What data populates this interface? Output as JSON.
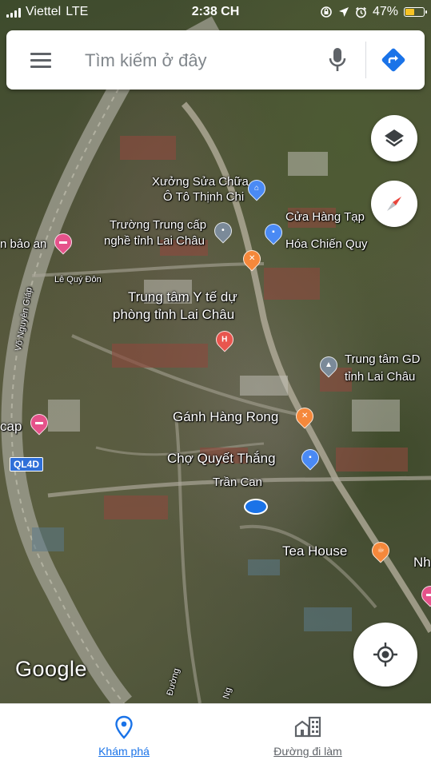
{
  "status_bar": {
    "carrier": "Viettel",
    "network": "LTE",
    "time": "2:38 CH",
    "battery_percent": "47%",
    "battery_level": 0.47
  },
  "search": {
    "placeholder": "Tìm kiếm ở đây"
  },
  "map": {
    "labels": {
      "xuong_sua_chua_1": "Xưởng Sửa Chữa",
      "xuong_sua_chua_2": "Ô Tô Thịnh Chi",
      "truong_trung_cap_1": "Trường Trung cấp",
      "truong_trung_cap_2": "nghề tỉnh Lai Châu",
      "cua_hang_1": "Cửa Hàng Tạp",
      "cua_hang_2": "Hóa Chiến Quy",
      "bao_an": "n bảo an",
      "le_quy_don": "Lê Quý Đôn",
      "trung_tam_yte_1": "Trung tâm Y tế dự",
      "trung_tam_yte_2": "phòng tỉnh Lai Châu",
      "vo_nguyen_giap": "Võ Nguyên Giáp",
      "trung_tam_gd_1": "Trung tâm GD",
      "trung_tam_gd_2": "tỉnh Lai Châu",
      "ganh_hang_rong": "Gánh Hàng Rong",
      "cap": "cap",
      "cho_quyet_thang": "Chợ Quyết Thắng",
      "tran_can": "Trần Can",
      "tea_house": "Tea House",
      "nh": "Nh",
      "duong_1": "Đường",
      "ng": "Ng"
    },
    "road_shield": "QL4D",
    "attribution": "Google"
  },
  "bottom_nav": {
    "explore_label": "Khám phá",
    "commute_label": "Đường đi làm"
  },
  "colors": {
    "accent": "#1a73e8",
    "battery": "#f7c325",
    "pin_orange": "#f5883b",
    "pin_pink": "#e5528a",
    "pin_blue": "#4a8af4"
  }
}
